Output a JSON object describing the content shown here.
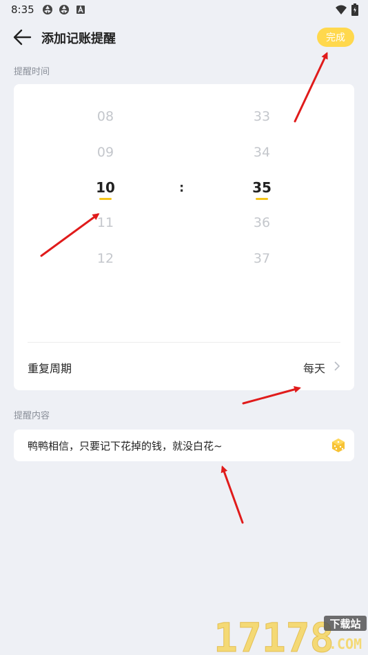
{
  "status_bar": {
    "time": "8:35",
    "left_icons": [
      "aperture-icon",
      "aperture-icon",
      "a-badge-icon"
    ],
    "right_icons": [
      "wifi-icon",
      "battery-icon"
    ]
  },
  "header": {
    "title": "添加记账提醒",
    "done_label": "完成",
    "accent_color": "#ffd84d"
  },
  "reminder_time": {
    "section_label": "提醒时间",
    "hours": [
      "08",
      "09",
      "10",
      "11",
      "12"
    ],
    "minutes": [
      "33",
      "34",
      "35",
      "36",
      "37"
    ],
    "selected_hour": "10",
    "selected_minute": "35",
    "separator": ":",
    "repeat_label": "重复周期",
    "repeat_value": "每天"
  },
  "reminder_content": {
    "section_label": "提醒内容",
    "text": "鸭鸭相信，只要记下花掉的钱，就没白花~"
  },
  "watermark": {
    "number": "17178",
    "site_label": "下载站",
    "domain": ".COM"
  }
}
